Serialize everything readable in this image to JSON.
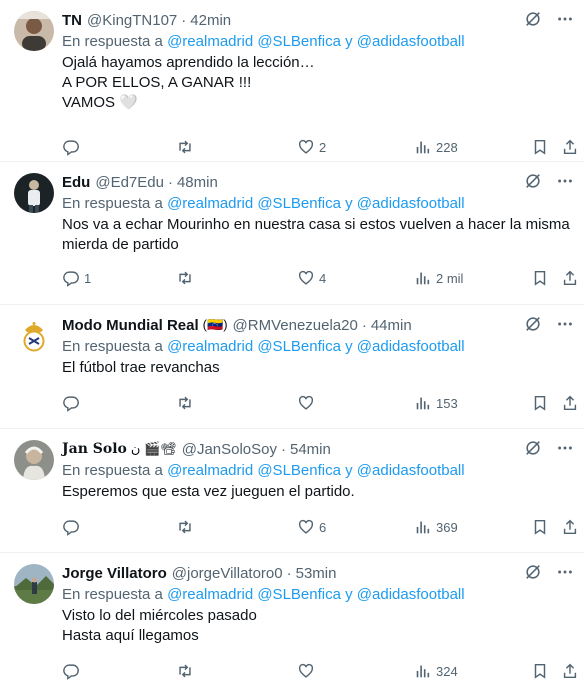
{
  "reply_prefix": "En respuesta a",
  "tweets": [
    {
      "name": "TN",
      "handle": "@KingTN107",
      "time": "42min",
      "mentions_a": "@realmadrid @SLBenfica",
      "connector": "y",
      "mentions_b": "@adidasfootball",
      "text": "Ojalá hayamos aprendido la lección…\nA POR ELLOS, A GANAR !!!\nVAMOS 🤍",
      "replies": "",
      "retweets": "",
      "likes": "2",
      "views": "228"
    },
    {
      "name": "Edu",
      "handle": "@Ed7Edu",
      "time": "48min",
      "mentions_a": "@realmadrid @SLBenfica",
      "connector": "y",
      "mentions_b": "@adidasfootball",
      "text": "Nos va a echar Mourinho en nuestra casa si estos vuelven a hacer la misma mierda de partido",
      "replies": "1",
      "retweets": "",
      "likes": "4",
      "views": "2 mil"
    },
    {
      "name": "Modo Mundial Real",
      "emoji": "(🇻🇪)",
      "handle": "@RMVenezuela20",
      "time": "44min",
      "mentions_a": "@realmadrid @SLBenfica",
      "connector": "y",
      "mentions_b": "@adidasfootball",
      "text": "El fútbol trae revanchas",
      "replies": "",
      "retweets": "",
      "likes": "",
      "views": "153"
    },
    {
      "name": "Jan Solo",
      "emoji": "ن 🎬📽",
      "handle": "@JanSoloSoy",
      "time": "54min",
      "mentions_a": "@realmadrid @SLBenfica",
      "connector": "y",
      "mentions_b": "@adidasfootball",
      "text": "Esperemos que esta vez jueguen el partido.",
      "replies": "",
      "retweets": "",
      "likes": "6",
      "views": "369"
    },
    {
      "name": "Jorge Villatoro",
      "handle": "@jorgeVillatoro0",
      "time": "53min",
      "mentions_a": "@realmadrid @SLBenfica",
      "connector": "y",
      "mentions_b": "@adidasfootball",
      "text": "Visto lo del miércoles pasado\nHasta aquí llegamos",
      "replies": "",
      "retweets": "",
      "likes": "",
      "views": "324"
    }
  ],
  "icons": [
    "grok-icon",
    "more-icon",
    "reply-icon",
    "retweet-icon",
    "like-icon",
    "views-icon",
    "bookmark-icon",
    "share-icon"
  ],
  "colors": {
    "link": "#1d9bf0",
    "muted": "#536471",
    "text": "#0f1419",
    "divider": "#eff3f4"
  }
}
